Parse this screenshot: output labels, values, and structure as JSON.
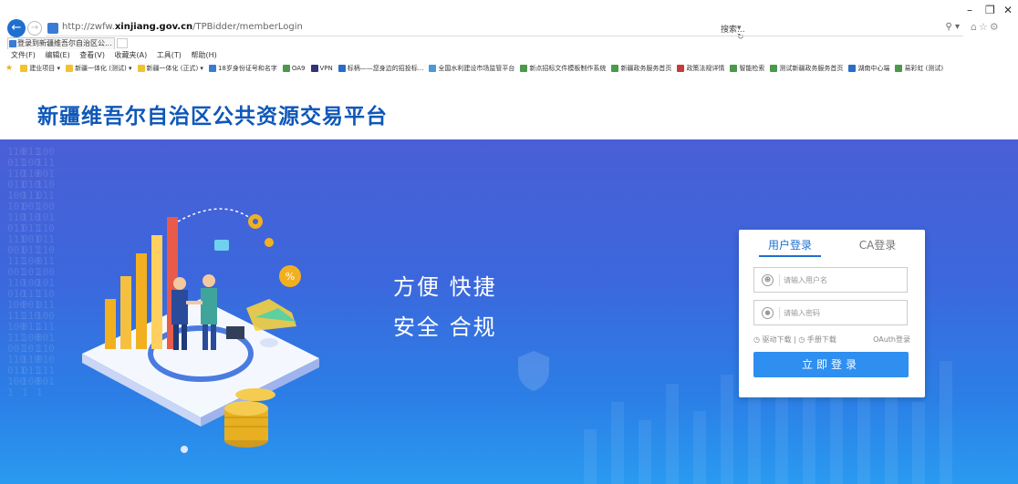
{
  "browser": {
    "url_prefix": "http://zwfw.",
    "url_domain": "xinjiang.gov.cn",
    "url_path": "/TPBidder/memberLogin",
    "addr_controls": "▾ ↻",
    "search_placeholder": "搜索...",
    "search_icon": "⚲ ▾",
    "toolbar_icons": "⌂☆⚙",
    "min": "–",
    "max": "❐",
    "close": "✕",
    "tab_title": "登录到新疆维吾尔自治区公... ×",
    "menu": [
      "文件(F)",
      "编辑(E)",
      "查看(V)",
      "收藏夹(A)",
      "工具(T)",
      "帮助(H)"
    ],
    "favorites": [
      {
        "label": "建业项目 ▾",
        "color": "#f2c230"
      },
      {
        "label": "新疆一体化 (测试) ▾",
        "color": "#f2c230"
      },
      {
        "label": "新疆一体化 (正式) ▾",
        "color": "#f2c230"
      },
      {
        "label": "18岁身份证号和名字",
        "color": "#3a7bd5"
      },
      {
        "label": "OA9",
        "color": "#4a9a4a"
      },
      {
        "label": "VPN",
        "color": "#333377"
      },
      {
        "label": "标柄——您身边的招投标...",
        "color": "#2a6cc8"
      },
      {
        "label": "全国水利建设市场监管平台",
        "color": "#4a9ad5"
      },
      {
        "label": "新点招标文件模板制作系统",
        "color": "#4a9a4a"
      },
      {
        "label": "新疆政务服务首页",
        "color": "#4a9a4a"
      },
      {
        "label": "政策法规详情",
        "color": "#c83a3a"
      },
      {
        "label": "智能检索",
        "color": "#4a9a4a"
      },
      {
        "label": "测试新疆政务服务首页",
        "color": "#4a9a4a"
      },
      {
        "label": "湖南中心端",
        "color": "#2a6cc8"
      },
      {
        "label": "易彩虹 (测试)",
        "color": "#4a9a4a"
      }
    ]
  },
  "site": {
    "title": "新疆维吾尔自治区公共资源交易平台"
  },
  "banner": {
    "slogan_line1": "方便  快捷",
    "slogan_line2": "安全  合规"
  },
  "login": {
    "tab_user": "用户登录",
    "tab_ca": "CA登录",
    "username_placeholder": "请输入用户名",
    "password_placeholder": "请输入密码",
    "link_driver": "◷ 驱动下载",
    "link_sep": " | ",
    "link_manual": "◷ 手册下载",
    "link_oauth": "OAuth登录",
    "submit": "立即登录"
  },
  "colors": {
    "title": "#0f57b8",
    "banner_top": "#4a5fd6",
    "banner_bottom": "#2a9af0",
    "button": "#2e8ff0"
  }
}
